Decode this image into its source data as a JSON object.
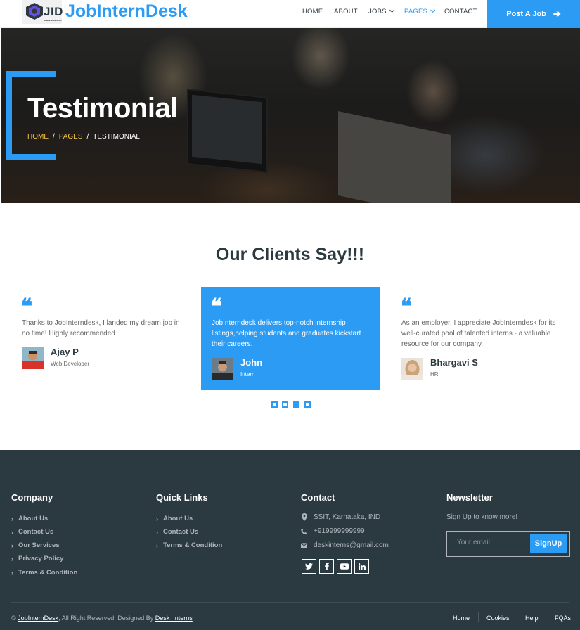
{
  "brand": {
    "logo_text": "JID",
    "logo_subtext": "JOBINTERNDESK",
    "name": "JobInternDesk"
  },
  "nav": {
    "items": [
      "HOME",
      "ABOUT",
      "JOBS",
      "PAGES",
      "CONTACT"
    ],
    "active": "PAGES",
    "post_job": "Post A Job"
  },
  "hero": {
    "title": "Testimonial",
    "breadcrumb": [
      "HOME",
      "PAGES",
      "TESTIMONIAL"
    ],
    "separator": "/"
  },
  "testimonials": {
    "heading": "Our Clients Say!!!",
    "items": [
      {
        "text": "Thanks to JobInterndesk, I landed my dream job in no time! Highly recommended",
        "name": "Ajay P",
        "role": "Web Developer"
      },
      {
        "text": "JobInterndesk delivers top-notch internship listings,helping students and graduates kickstart their careers.",
        "name": "John",
        "role": "Intern"
      },
      {
        "text": "As an employer, I appreciate JobInterndesk for its well-curated pool of talented interns - a valuable resource for our company.",
        "name": "Bhargavi S",
        "role": "HR"
      }
    ],
    "dots": 4,
    "active_dot": 3
  },
  "footer": {
    "company": {
      "title": "Company",
      "links": [
        "About Us",
        "Contact Us",
        "Our Services",
        "Privacy Policy",
        "Terms & Condition"
      ]
    },
    "quick_links": {
      "title": "Quick Links",
      "links": [
        "About Us",
        "Contact Us",
        "Terms & Condition"
      ]
    },
    "contact": {
      "title": "Contact",
      "address": "SSIT, Karnataka, IND",
      "phone": "+919999999999",
      "email": "deskinterns@gmail.com"
    },
    "newsletter": {
      "title": "Newsletter",
      "subtitle": "Sign Up to know more!",
      "placeholder": "Your email",
      "button": "SignUp"
    },
    "copyright": {
      "prefix": "©",
      "site": "JobInternDesk",
      "middle": ", All Right Reserved. Designed By",
      "designer": "Desk_Interns"
    },
    "bottom_links": [
      "Home",
      "Cookies",
      "Help",
      "FQAs"
    ]
  },
  "colors": {
    "accent": "#2b9bf4",
    "dark": "#2b3940",
    "breadcrumb": "#f7c544"
  }
}
